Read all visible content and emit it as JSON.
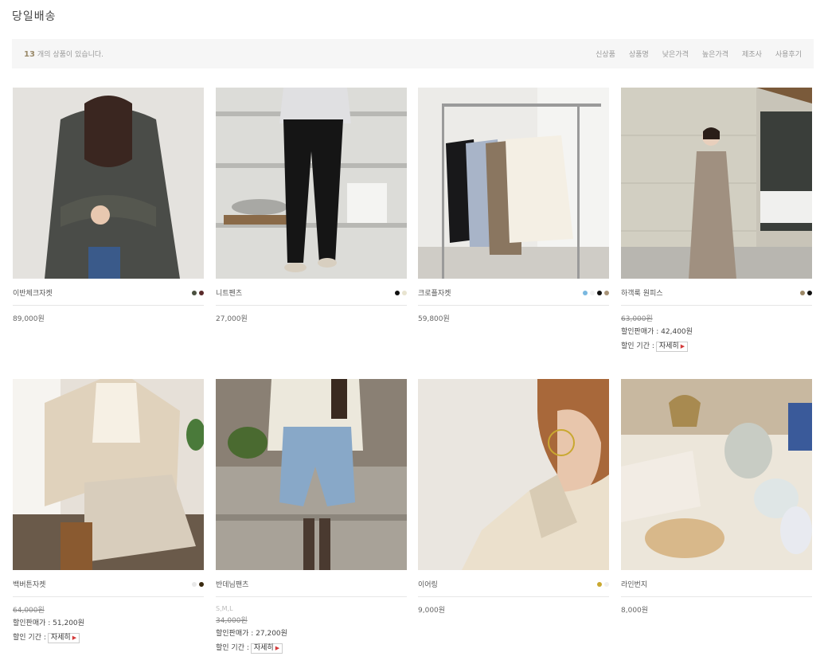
{
  "page": {
    "title": "당일배송"
  },
  "toolbar": {
    "count_num": "13",
    "count_text": "개의 상품이 있습니다.",
    "sort": [
      "신상품",
      "상품명",
      "낮은가격",
      "높은가격",
      "제조사",
      "사용후기"
    ]
  },
  "products": [
    {
      "name": "이반체크자켓",
      "price": "89,000원",
      "colors": [
        "#4a5040",
        "#5a2a2a"
      ]
    },
    {
      "name": "니트펜츠",
      "price": "27,000원",
      "colors": [
        "#111111",
        "#e8e4d0"
      ]
    },
    {
      "name": "크로플자켓",
      "price": "59,800원",
      "colors": [
        "#7ab8e0",
        "#f0f0f0",
        "#111111",
        "#a89478"
      ]
    },
    {
      "name": "하객룩 원피스",
      "original": "63,000원",
      "sale_label": "할인판매가 :",
      "sale_price": "42,400원",
      "period_label": "할인 기간 :",
      "detail": "자세히",
      "colors": [
        "#9c8866",
        "#111111"
      ]
    },
    {
      "name": "백버튼자켓",
      "original": "64,000원",
      "sale_label": "할인판매가 :",
      "sale_price": "51,200원",
      "period_label": "할인 기간 :",
      "detail": "자세히",
      "colors": [
        "#e8e8e8",
        "#3a2a10"
      ]
    },
    {
      "name": "반데님팬츠",
      "sub": "S,M,L",
      "original": "34,000원",
      "sale_label": "할인판매가 :",
      "sale_price": "27,200원",
      "period_label": "할인 기간 :",
      "detail": "자세히",
      "colors": []
    },
    {
      "name": "이어링",
      "price": "9,000원",
      "colors": [
        "#c9a830",
        "#f0f0f0"
      ]
    },
    {
      "name": "라인번지",
      "price": "8,000원",
      "colors": []
    }
  ]
}
